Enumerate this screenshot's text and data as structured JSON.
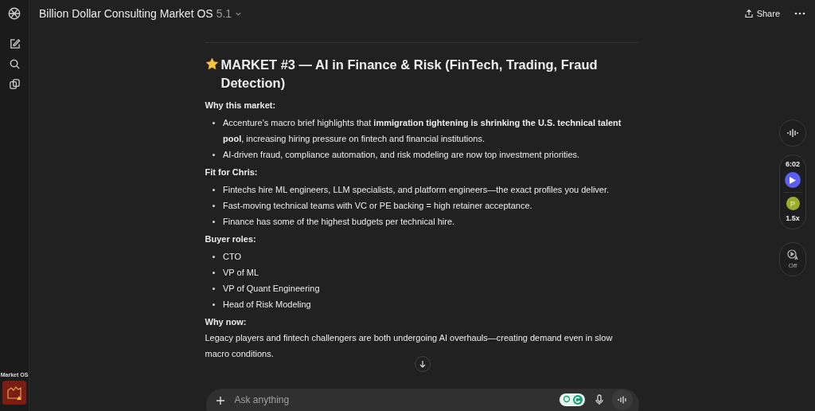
{
  "header": {
    "title": "Billion Dollar Consulting Market OS",
    "version": "5.1",
    "share": "Share"
  },
  "sidebar": {
    "app_label": "Market OS"
  },
  "article": {
    "title": "MARKET #3 — AI in Finance & Risk (FinTech, Trading, Fraud Detection)",
    "sections": [
      {
        "heading": "Why this market:",
        "bullets": [
          "Accenture’s macro brief highlights that **immigration tightening is shrinking the U.S. technical talent pool**, increasing hiring pressure on fintech and financial institutions.",
          "AI-driven fraud, compliance automation, and risk modeling are now top investment priorities."
        ]
      },
      {
        "heading": "Fit for Chris:",
        "bullets": [
          "Fintechs hire ML engineers, LLM specialists, and platform engineers—the exact profiles you deliver.",
          "Fast-moving technical teams with VC or PE backing = high retainer acceptance.",
          "Finance has some of the highest budgets per technical hire."
        ]
      },
      {
        "heading": "Buyer roles:",
        "bullets": [
          "CTO",
          "VP of ML",
          "VP of Quant Engineering",
          "Head of Risk Modeling"
        ]
      },
      {
        "heading": "Why now:",
        "paragraph": "Legacy players and fintech challengers are both undergoing AI overhauls—creating demand even in slow macro conditions."
      }
    ]
  },
  "player": {
    "time": "6:02",
    "avatar": "P",
    "speed": "1.5x",
    "autoplay": "Off"
  },
  "composer": {
    "placeholder": "Ask anything"
  }
}
